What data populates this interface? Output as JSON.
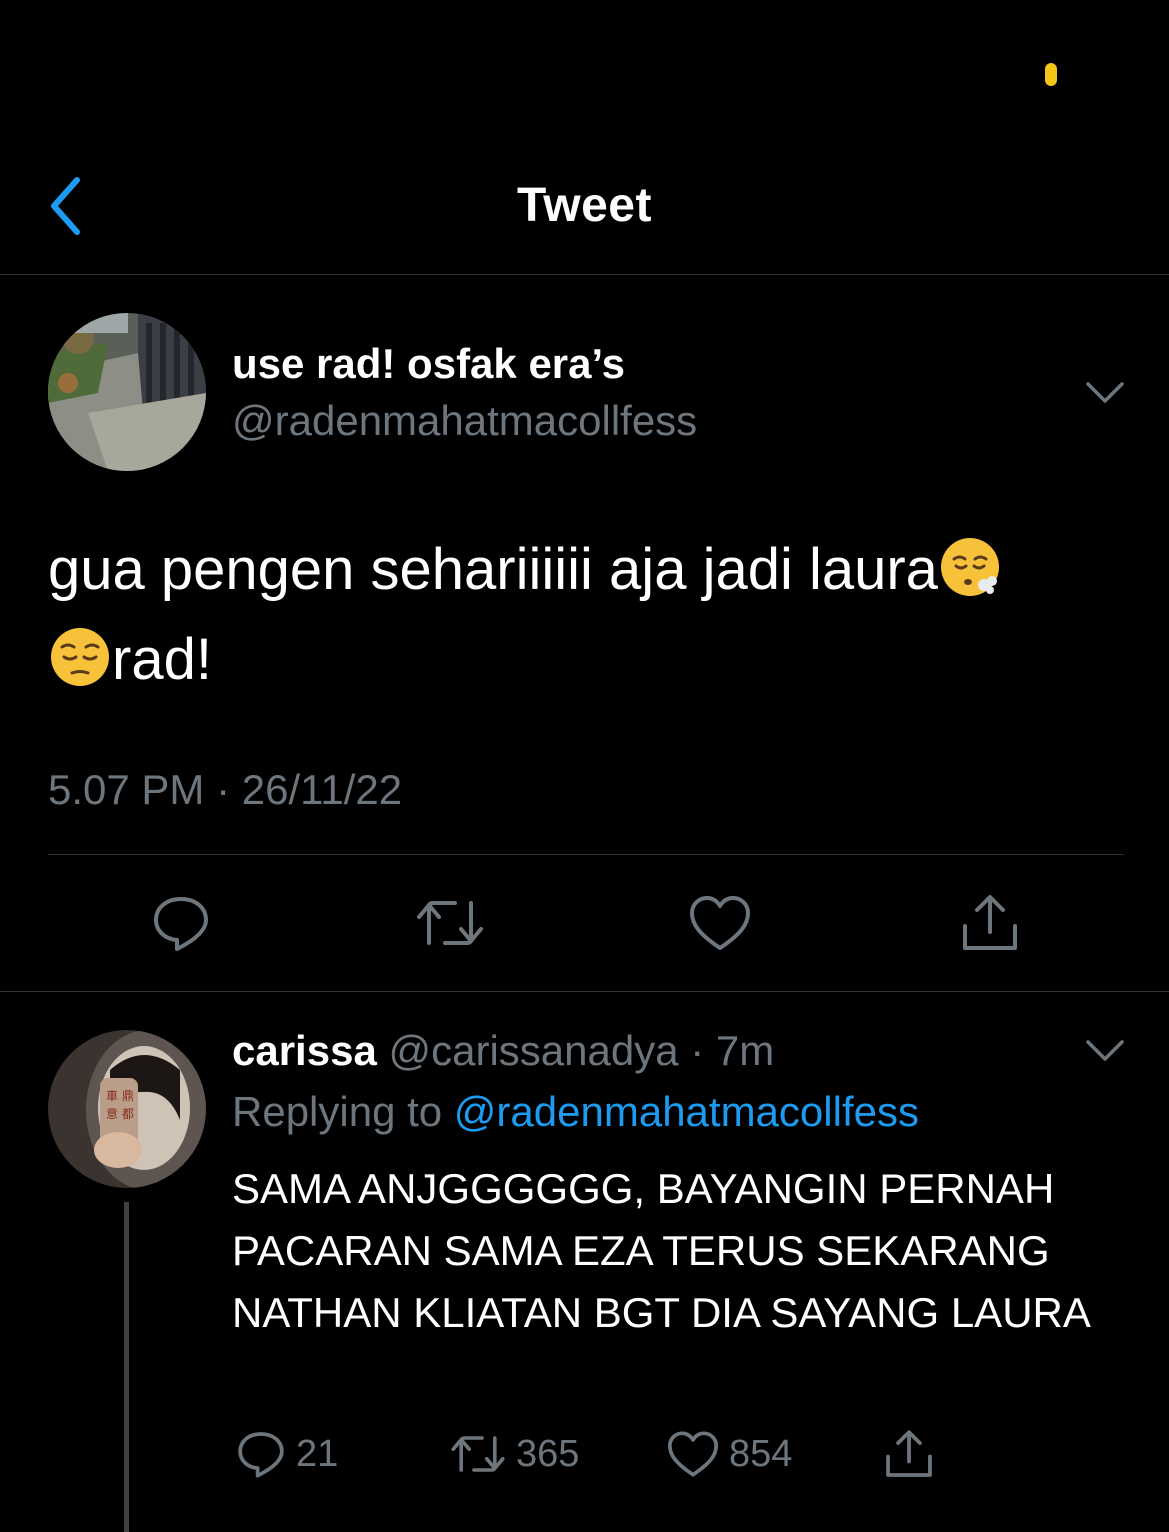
{
  "status_bar": {
    "indicator_color": "#f5c518"
  },
  "header": {
    "title": "Tweet",
    "back_icon": "chevron-left-icon"
  },
  "tweet": {
    "author_name": "use rad! osfak era’s",
    "author_handle": "@radenmahatmacollfess",
    "text_line1": "gua pengen sehariiiiii aja jadi laura",
    "text_line2": "rad!",
    "emojis": [
      "face-exhaling-emoji",
      "pensive-face-emoji"
    ],
    "timestamp": "5.07 PM · 26/11/22",
    "actions": [
      "reply-icon",
      "retweet-icon",
      "like-icon",
      "share-icon"
    ]
  },
  "reply": {
    "author_name": "carissa",
    "author_handle": "@carissanadya",
    "time": "· 7m",
    "replying_prefix": "Replying to",
    "replying_handle": "@radenmahatmacollfess",
    "text": "SAMA ANJGGGGGG, BAYANGIN PERNAH PACARAN SAMA EZA TERUS SEKARANG NATHAN KLIATAN BGT DIA SAYANG LAURA",
    "reply_count": "21",
    "retweet_count": "365",
    "like_count": "854"
  },
  "colors": {
    "background": "#000000",
    "muted": "#6e767d",
    "link": "#1d9bf0",
    "divider": "#2f3336"
  }
}
